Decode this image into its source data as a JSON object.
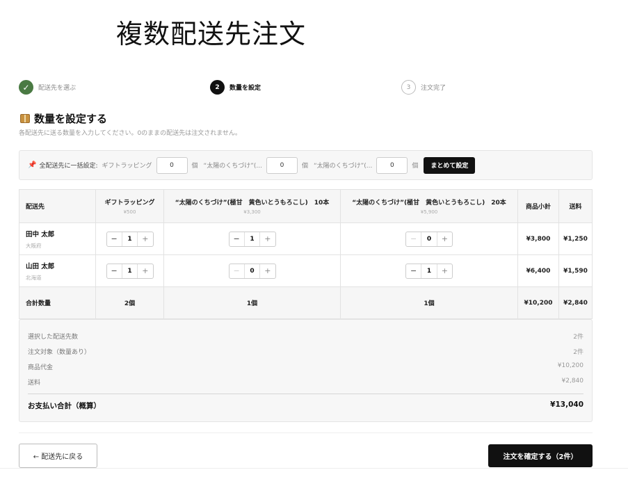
{
  "page_title": "複数配送先注文",
  "steps": [
    {
      "marker": "✓",
      "label": "配送先を選ぶ"
    },
    {
      "marker": "2",
      "label": "数量を設定"
    },
    {
      "marker": "3",
      "label": "注文完了"
    }
  ],
  "section": {
    "title": "数量を設定する",
    "subtitle": "各配送先に送る数量を入力してください。0のままの配送先は注文されません。"
  },
  "bulk": {
    "pin_icon": "📌",
    "label": "全配送先に一括設定:",
    "items": [
      {
        "label": "ギフトラッピング",
        "value": "0",
        "unit": "個"
      },
      {
        "label": "“太陽のくちづけ”(...",
        "value": "0",
        "unit": "個"
      },
      {
        "label": "“太陽のくちづけ”(...",
        "value": "0",
        "unit": "個"
      }
    ],
    "button": "まとめて設定"
  },
  "table": {
    "headers": {
      "destination": "配送先",
      "products": [
        {
          "name": "ギフトラッピング",
          "price": "¥500"
        },
        {
          "name": "“太陽のくちづけ”(極甘　黄色いとうもろこし)　10本",
          "price": "¥3,300"
        },
        {
          "name": "“太陽のくちづけ”(極甘　黄色いとうもろこし)　20本",
          "price": "¥5,900"
        }
      ],
      "subtotal": "商品小計",
      "shipping": "送料"
    },
    "rows": [
      {
        "name": "田中 太郎",
        "pref": "大阪府",
        "qty": [
          "1",
          "1",
          "0"
        ],
        "subtotal": "¥3,800",
        "shipping": "¥1,250"
      },
      {
        "name": "山田 太郎",
        "pref": "北海道",
        "qty": [
          "1",
          "0",
          "1"
        ],
        "subtotal": "¥6,400",
        "shipping": "¥1,590"
      }
    ],
    "total": {
      "label": "合計数量",
      "qty": [
        "2個",
        "1個",
        "1個"
      ],
      "subtotal": "¥10,200",
      "shipping": "¥2,840"
    }
  },
  "summary": {
    "rows": [
      {
        "label": "選択した配送先数",
        "value": "2件"
      },
      {
        "label": "注文対象（数量あり）",
        "value": "2件"
      },
      {
        "label": "商品代金",
        "value": "¥10,200"
      },
      {
        "label": "送料",
        "value": "¥2,840"
      }
    ],
    "total_label": "お支払い合計（概算）",
    "total_value": "¥13,040"
  },
  "buttons": {
    "back": "← 配送先に戻る",
    "confirm": "注文を確定する（2件）"
  },
  "stepper_symbols": {
    "minus": "−",
    "plus": "+"
  },
  "colors": {
    "step_done": "#4a7a43",
    "primary": "#111111"
  }
}
